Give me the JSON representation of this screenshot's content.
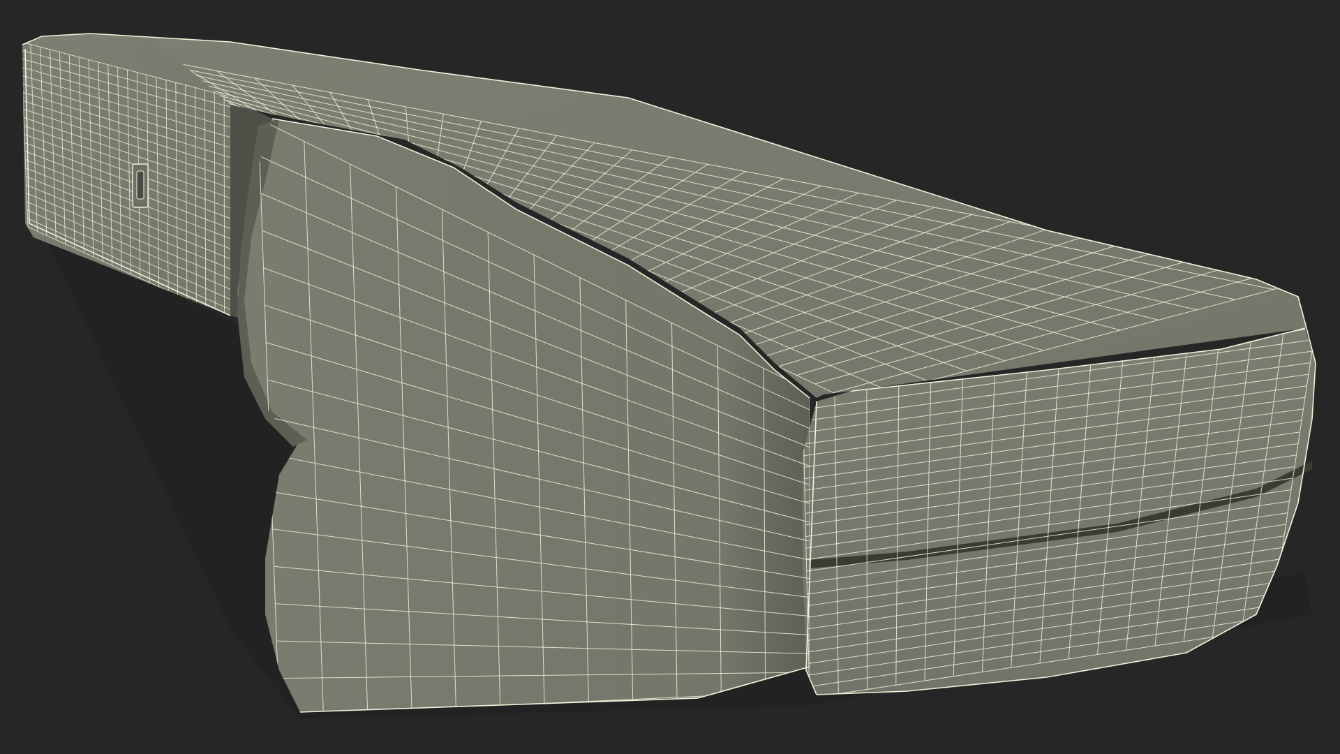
{
  "scene": {
    "subject": "3d-wireframe-model",
    "colors": {
      "background": "#262626",
      "surface": "#7a7b6e",
      "surface_dark": "#56574d",
      "surface_light": "#85867a",
      "wire": "#f2f2dc",
      "edge_shadow": "#2a2b26"
    }
  }
}
